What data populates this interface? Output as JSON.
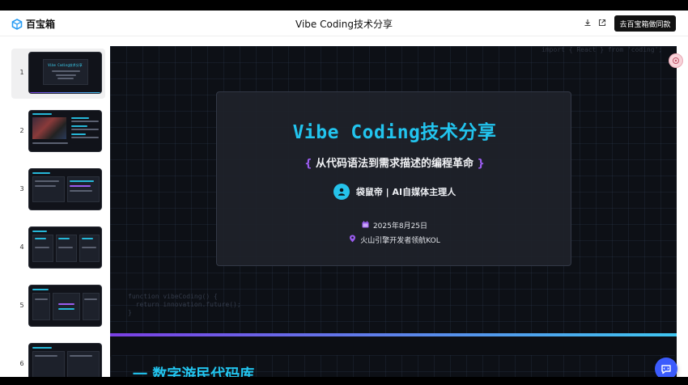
{
  "app": {
    "logo_text": "百宝箱",
    "doc_title": "Vibe Coding技术分享",
    "cta_label": "去百宝箱做同款"
  },
  "header_icons": [
    "download-icon",
    "external-link-icon"
  ],
  "sidebar": {
    "thumbnails": [
      {
        "num": "1",
        "title": "Vibe Coding技术分享"
      },
      {
        "num": "2"
      },
      {
        "num": "3"
      },
      {
        "num": "4"
      },
      {
        "num": "5"
      },
      {
        "num": "6"
      }
    ]
  },
  "slide": {
    "title": "Vibe Coding技术分享",
    "subtitle_open": "{",
    "subtitle": "从代码语法到需求描述的编程革命",
    "subtitle_close": "}",
    "author": "袋鼠帝 | AI自媒体主理人",
    "date": "2025年8月25日",
    "location": "火山引擎开发者领航KOL",
    "code_top": "import { React } from 'coding';",
    "code_bottom_1": "function vibeCoding() {",
    "code_bottom_2": "  return innovation.future();",
    "code_bottom_3": "}"
  },
  "next_slide": {
    "title_fragment": "一 数字游民代码库"
  },
  "colors": {
    "accent_cyan": "#22c4ee",
    "accent_purple": "#9b5cf0",
    "cta_bg": "#111111",
    "chat_fab": "#3b5bfc"
  }
}
